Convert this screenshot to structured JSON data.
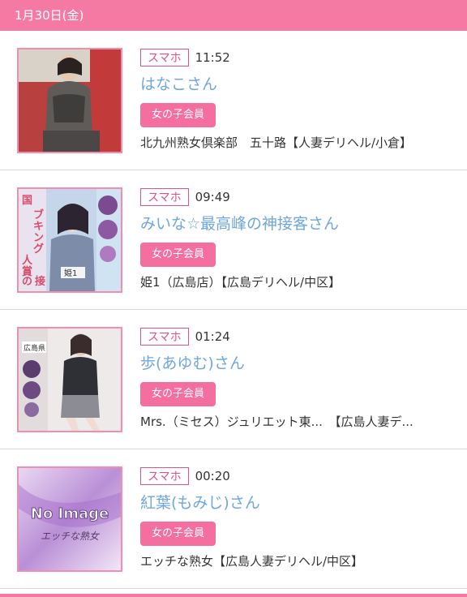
{
  "date_header": "1月30日(金)",
  "entries": [
    {
      "device": "スマホ",
      "time": "11:52",
      "name": "はなこさん",
      "badge": "女の子会員",
      "shop": "北九州熟女倶楽部　五十路【人妻デリヘル/小倉】"
    },
    {
      "device": "スマホ",
      "time": "09:49",
      "name": "みいな☆最高峰の神接客さん",
      "badge": "女の子会員",
      "shop": "姫1（広島店）【広島デリヘル/中区】",
      "thumb_text": [
        "国",
        "ブ",
        "キ",
        "ン",
        "グ",
        "人",
        "賞",
        "の",
        "接"
      ],
      "thumb_tag": "姫1"
    },
    {
      "device": "スマホ",
      "time": "01:24",
      "name": "歩(あゆむ)さん",
      "badge": "女の子会員",
      "shop": "Mrs.（ミセス）ジュリエット東...　【広島人妻デ...",
      "thumb_tag": "広島県"
    },
    {
      "device": "スマホ",
      "time": "00:20",
      "name": "紅葉(もみじ)さん",
      "badge": "女の子会員",
      "shop": "エッチな熟女【広島人妻デリヘル/中区】",
      "thumb_title": "No Image",
      "thumb_sub": "エッチな熟女"
    }
  ],
  "colors": {
    "accent": "#f47aa4",
    "link": "#6fa6de",
    "badge": "#f46e9f"
  }
}
